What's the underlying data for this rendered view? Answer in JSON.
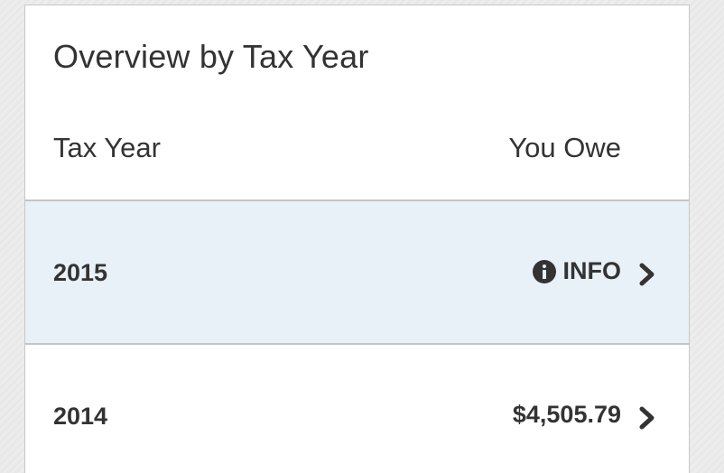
{
  "card": {
    "title": "Overview by Tax Year",
    "headers": {
      "year": "Tax Year",
      "owe": "You Owe"
    },
    "rows": [
      {
        "year": "2015",
        "value": "INFO",
        "icon": "info-icon",
        "highlighted": true
      },
      {
        "year": "2014",
        "value": "$4,505.79",
        "icon": "",
        "highlighted": false
      }
    ]
  },
  "colors": {
    "highlight_bg": "#e8f1f8",
    "text": "#333333",
    "divider": "#c4c4c4"
  }
}
